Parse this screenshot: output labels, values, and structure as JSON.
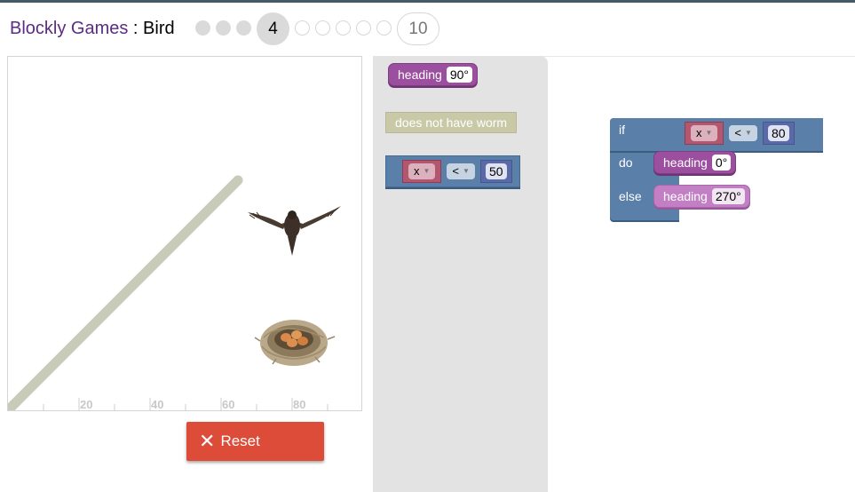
{
  "header": {
    "app_name": "Blockly Games",
    "separator": " : ",
    "game_name": "Bird",
    "levels": [
      {
        "label": "",
        "state": "done"
      },
      {
        "label": "",
        "state": "done"
      },
      {
        "label": "",
        "state": "done"
      },
      {
        "label": "4",
        "state": "current"
      },
      {
        "label": "",
        "state": "empty"
      },
      {
        "label": "",
        "state": "empty"
      },
      {
        "label": "",
        "state": "empty"
      },
      {
        "label": "",
        "state": "empty"
      },
      {
        "label": "",
        "state": "empty"
      },
      {
        "label": "10",
        "state": "last"
      }
    ]
  },
  "visualization": {
    "axis_ticks": [
      "20",
      "40",
      "60",
      "80"
    ],
    "wall_color": "#c7cbb8",
    "bird_icon": "bird-icon",
    "nest_icon": "nest-with-eggs-icon"
  },
  "reset_button": {
    "icon": "close-icon",
    "label": "Reset",
    "color": "#dd4b39"
  },
  "toolbox": {
    "heading_block": {
      "label": "heading",
      "value": "90°"
    },
    "worm_block": {
      "label": "does not have worm"
    },
    "compare_block": {
      "variable": "x",
      "operator": "<",
      "value": "50"
    }
  },
  "workspace": {
    "if_block": {
      "if_label": "if",
      "do_label": "do",
      "else_label": "else",
      "condition": {
        "variable": "x",
        "operator": "<",
        "value": "80"
      },
      "do_heading": {
        "label": "heading",
        "value": "0°"
      },
      "else_heading": {
        "label": "heading",
        "value": "270°"
      }
    }
  }
}
